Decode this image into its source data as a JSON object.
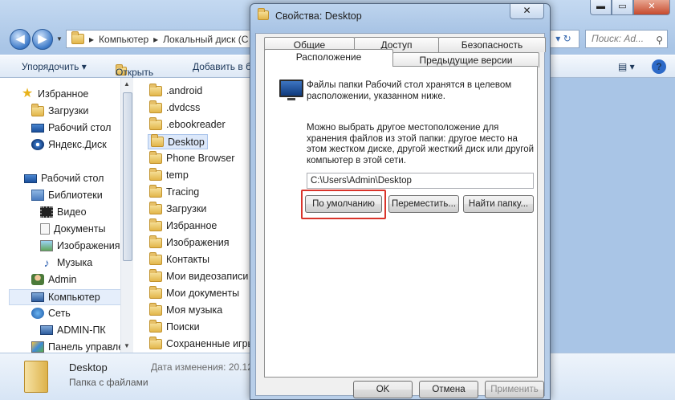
{
  "explorer": {
    "window_controls": {
      "minimize": "▬",
      "maximize": "▭",
      "close": "✕"
    },
    "nav": {
      "back": "◀",
      "forward": "▶",
      "dropdown": "▼"
    },
    "address": {
      "parts": [
        "Компьютер",
        "Локальный диск (C"
      ],
      "separator": "▸"
    },
    "address_right": "▾ ↻",
    "search_placeholder": "Поиск: Ad...",
    "toolbar": {
      "organize": "Упорядочить ▾",
      "open": "Открыть",
      "add_to": "Добавить в б",
      "view": "▤ ▾",
      "help": "?"
    },
    "sidebar": {
      "favorites": "Избранное",
      "downloads": "Загрузки",
      "desktop": "Рабочий стол",
      "yandex": "Яндекс.Диск",
      "desktop2": "Рабочий стол",
      "libraries": "Библиотеки",
      "video": "Видео",
      "documents": "Документы",
      "images": "Изображения",
      "music": "Музыка",
      "admin": "Admin",
      "computer": "Компьютер",
      "network": "Сеть",
      "admin_pc": "ADMIN-ПК",
      "control_panel": "Панель управле"
    },
    "files": [
      ".android",
      ".dvdcss",
      ".ebookreader",
      "Desktop",
      "Phone Browser",
      "temp",
      "Tracing",
      "Загрузки",
      "Избранное",
      "Изображения",
      "Контакты",
      "Мои видеозаписи",
      "Мои документы",
      "Моя музыка",
      "Поиски",
      "Сохраненные игры"
    ],
    "details": {
      "name": "Desktop",
      "type": "Папка с файлами",
      "modified_label": "Дата изменения: 20.12"
    }
  },
  "dialog": {
    "title": "Свойства: Desktop",
    "close": "✕",
    "tabs_row1": [
      "Общие",
      "Доступ",
      "Безопасность"
    ],
    "tabs_row2": [
      "Расположение",
      "Предыдущие версии"
    ],
    "description": "Файлы папки Рабочий стол хранятся в целевом расположении, указанном ниже.",
    "hint": "Можно выбрать другое местоположение для хранения файлов из этой папки: другое место на этом жестком диске, другой жесткий диск или другой компьютер в этой сети.",
    "path": "C:\\Users\\Admin\\Desktop",
    "buttons": {
      "default": "По умолчанию",
      "move": "Переместить...",
      "find": "Найти папку..."
    },
    "footer": {
      "ok": "OK",
      "cancel": "Отмена",
      "apply": "Применить"
    }
  }
}
